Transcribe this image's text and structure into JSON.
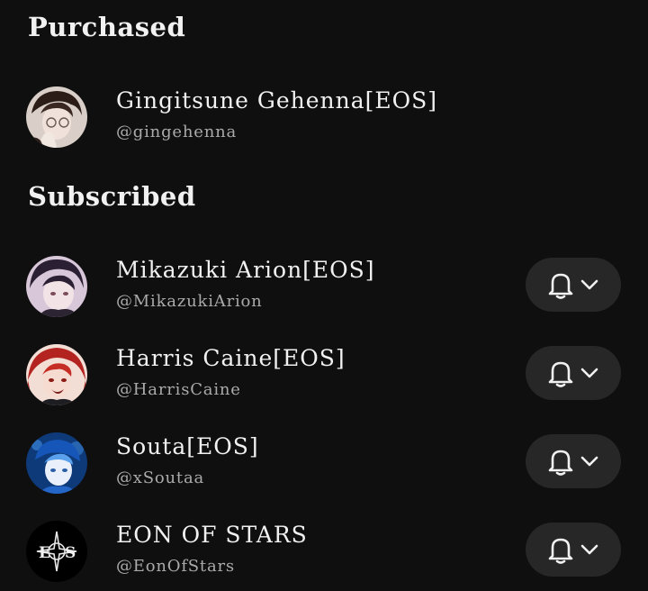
{
  "sections": {
    "purchased": {
      "title": "Purchased",
      "channels": [
        {
          "name": "Gingitsune Gehenna[EOS]",
          "handle": "@gingehenna",
          "avatar_icon": "avatar-character-portrait"
        }
      ]
    },
    "subscribed": {
      "title": "Subscribed",
      "channels": [
        {
          "name": "Mikazuki Arion[EOS]",
          "handle": "@MikazukiArion",
          "avatar_icon": "avatar-character-portrait",
          "bell_icon": "bell-icon",
          "dropdown_icon": "chevron-down-icon"
        },
        {
          "name": "Harris Caine[EOS]",
          "handle": "@HarrisCaine",
          "avatar_icon": "avatar-character-portrait",
          "bell_icon": "bell-icon",
          "dropdown_icon": "chevron-down-icon"
        },
        {
          "name": "Souta[EOS]",
          "handle": "@xSoutaa",
          "avatar_icon": "avatar-character-portrait",
          "bell_icon": "bell-icon",
          "dropdown_icon": "chevron-down-icon"
        },
        {
          "name": "EON OF STARS",
          "handle": "@EonOfStars",
          "avatar_icon": "eos-logo",
          "bell_icon": "bell-icon",
          "dropdown_icon": "chevron-down-icon"
        }
      ]
    }
  },
  "colors": {
    "background": "#0f0f0f",
    "text_primary": "#f1f1f1",
    "text_secondary": "#aaaaaa",
    "button_background": "#272727"
  }
}
